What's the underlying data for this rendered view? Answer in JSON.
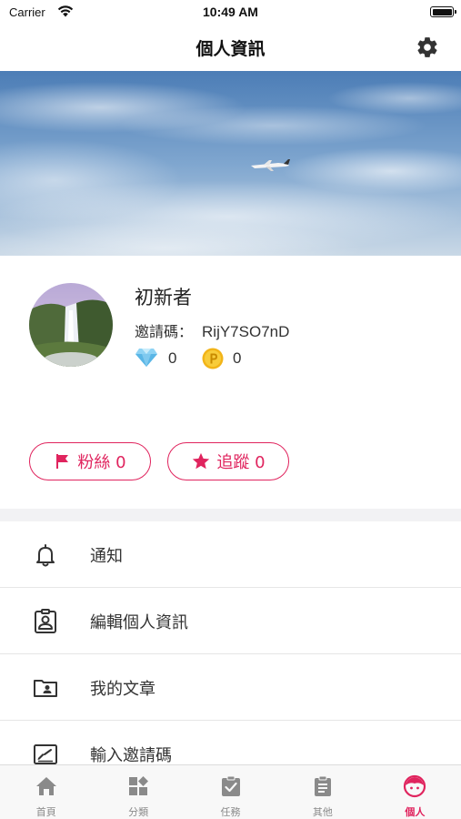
{
  "status_bar": {
    "carrier": "Carrier",
    "time": "10:49 AM"
  },
  "nav": {
    "title": "個人資訊",
    "settings_icon": "gear-icon"
  },
  "banner": {
    "image": "sky-with-airplane"
  },
  "profile": {
    "username": "初新者",
    "invite_label": "邀請碼：",
    "invite_code": "RijY7SO7nD",
    "diamonds": "0",
    "points": "0",
    "fans_label": "粉絲 0",
    "follow_label": "追蹤 0"
  },
  "menu": {
    "items": [
      {
        "label": "通知",
        "icon": "bell-icon"
      },
      {
        "label": "編輯個人資訊",
        "icon": "id-badge-icon"
      },
      {
        "label": "我的文章",
        "icon": "folder-user-icon"
      },
      {
        "label": "輸入邀請碼",
        "icon": "signature-icon"
      }
    ]
  },
  "tab_bar": {
    "tabs": [
      {
        "label": "首頁",
        "icon": "home-icon"
      },
      {
        "label": "分類",
        "icon": "category-icon"
      },
      {
        "label": "任務",
        "icon": "task-icon"
      },
      {
        "label": "其他",
        "icon": "clipboard-icon"
      },
      {
        "label": "個人",
        "icon": "face-icon"
      }
    ],
    "active": "個人"
  },
  "colors": {
    "accent": "#e0245e",
    "tab_inactive": "#8a8a8a",
    "divider": "#e6e6e6",
    "section_gap": "#f2f2f4"
  }
}
